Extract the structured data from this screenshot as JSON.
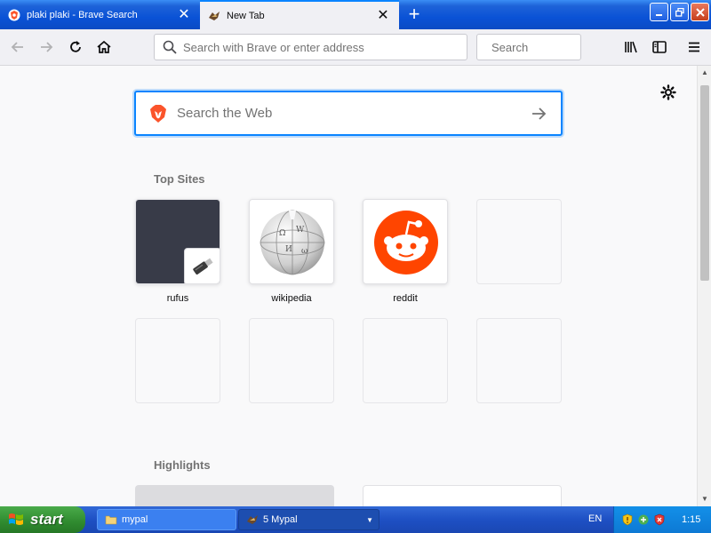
{
  "tabs": [
    {
      "title": "plaki plaki - Brave Search",
      "favicon": "brave-search-favicon",
      "active": false
    },
    {
      "title": "New Tab",
      "favicon": "mypal-favicon",
      "active": true
    }
  ],
  "window_buttons": {
    "minimize": "minimize-icon",
    "restore": "restore-icon",
    "close": "close-icon"
  },
  "toolbar": {
    "url_placeholder": "Search with Brave or enter address",
    "url_value": "",
    "search_placeholder": "Search",
    "search_value": ""
  },
  "content": {
    "websearch_placeholder": "Search the Web",
    "websearch_value": "",
    "top_sites_title": "Top Sites",
    "highlights_title": "Highlights",
    "top_sites": [
      {
        "label": "rufus",
        "icon": "usb-drive-icon"
      },
      {
        "label": "wikipedia",
        "icon": "wikipedia-globe-icon"
      },
      {
        "label": "reddit",
        "icon": "reddit-icon"
      }
    ]
  },
  "colors": {
    "accent": "#0a84ff",
    "reddit": "#ff4500",
    "brave": "#fb542b",
    "titlebar": "#0a52d6",
    "start_green": "#2f8a2f"
  },
  "taskbar": {
    "start_label": "start",
    "items": [
      {
        "label": "mypal",
        "icon": "folder-icon"
      },
      {
        "label": "5 Mypal",
        "icon": "mypal-icon"
      }
    ],
    "language": "EN",
    "clock": "1:15"
  }
}
